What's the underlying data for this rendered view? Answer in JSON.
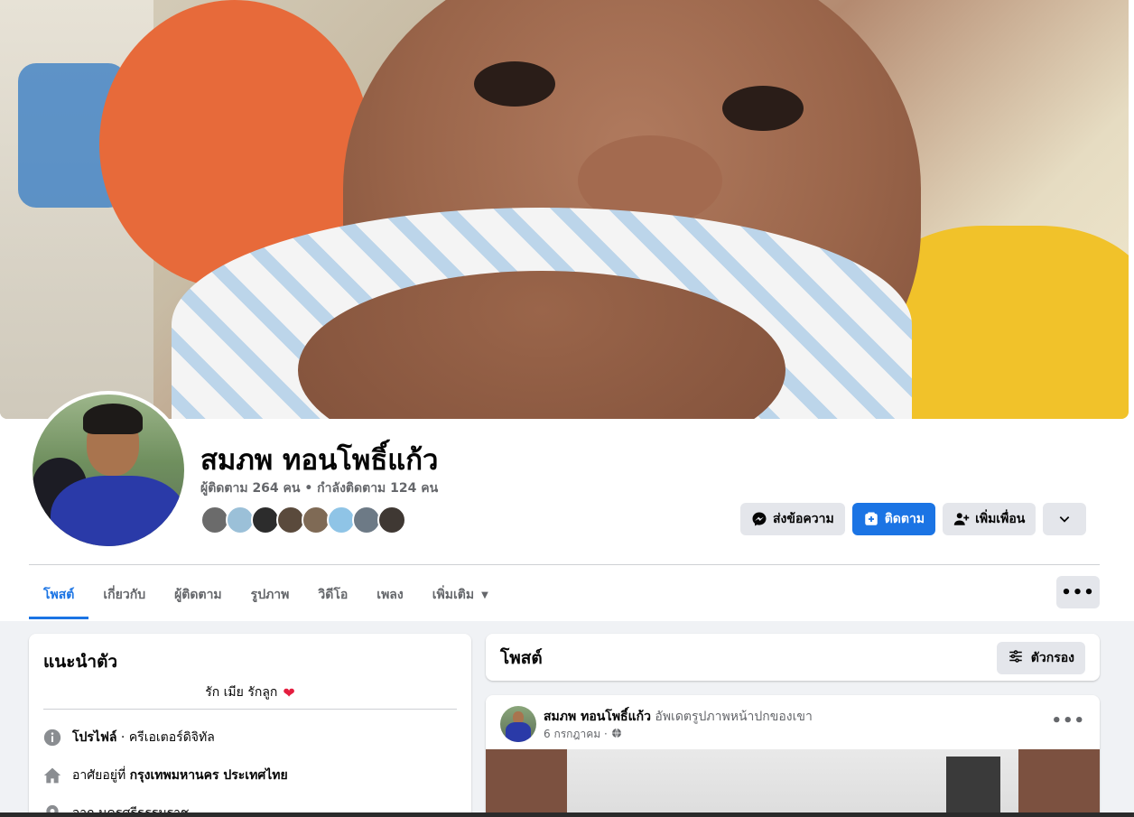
{
  "profile": {
    "name": "สมภพ ทอนโพธิ์แก้ว",
    "follow_line": "ผู้ติดตาม 264 คน • กำลังติดตาม 124 คน",
    "mutual_avatar_colors": [
      "#6b6b6b",
      "#9bc0d8",
      "#2c2c2c",
      "#5a4a3c",
      "#7f6a55",
      "#8fc4e6",
      "#6d7a86",
      "#3f3833"
    ]
  },
  "actions": {
    "message_label": "ส่งข้อความ",
    "follow_label": "ติดตาม",
    "add_friend_label": "เพิ่มเพื่อน"
  },
  "tabs": [
    {
      "label": "โพสต์",
      "active": true
    },
    {
      "label": "เกี่ยวกับ"
    },
    {
      "label": "ผู้ติดตาม"
    },
    {
      "label": "รูปภาพ"
    },
    {
      "label": "วิดีโอ"
    },
    {
      "label": "เพลง"
    },
    {
      "label": "เพิ่มเติม"
    }
  ],
  "intro": {
    "title": "แนะนำตัว",
    "bio": "รัก เมีย รักลูก",
    "profile_label": "โปรไฟล์",
    "profile_value": " · ครีเอเตอร์ดิจิทัล",
    "lives_prefix": "อาศัยอยู่ที่ ",
    "lives_value": "กรุงเทพมหานคร ประเทศไทย",
    "third_row": "จาก นครศรีธรรมราช"
  },
  "posts": {
    "title": "โพสต์",
    "filter_label": "ตัวกรอง",
    "post_author": "สมภพ ทอนโพธิ์แก้ว",
    "post_action": " อัพเดตรูปภาพหน้าปกของเขา",
    "post_date": "6 กรกฎาคม ·"
  },
  "colors": {
    "accent": "#1b74e4",
    "button_grey": "#e4e6eb",
    "page_bg": "#f0f2f5",
    "heart": "#e41e3f"
  }
}
